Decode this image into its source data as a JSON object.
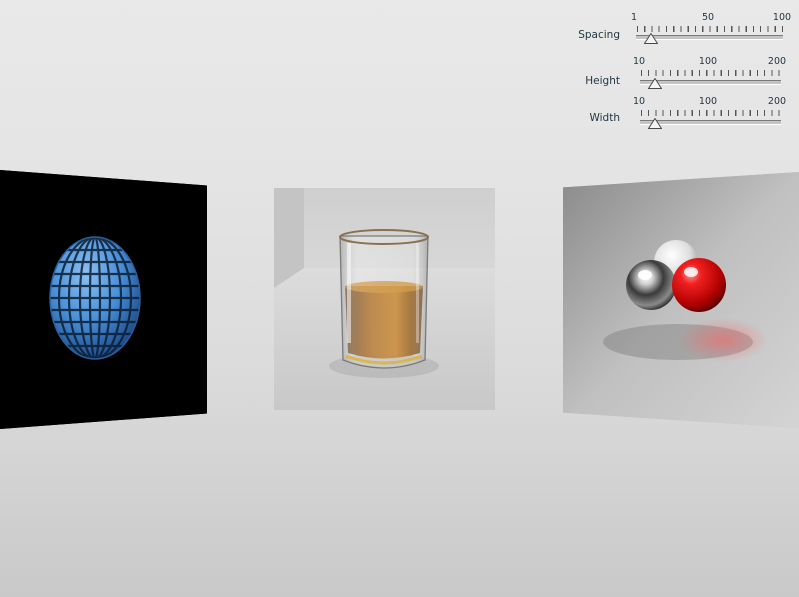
{
  "controls": {
    "spacing": {
      "label": "Spacing",
      "ticks": [
        "1",
        "50",
        "100"
      ],
      "min": 1,
      "max": 100,
      "value": 11
    },
    "height": {
      "label": "Height",
      "ticks": [
        "10",
        "100",
        "200"
      ],
      "min": 10,
      "max": 200,
      "value": 30
    },
    "width": {
      "label": "Width",
      "ticks": [
        "10",
        "100",
        "200"
      ],
      "min": 10,
      "max": 200,
      "value": 30
    }
  },
  "gallery": {
    "items": [
      {
        "subject": "blue-lattice-egg",
        "background": "#000000",
        "accent": "#4a8fd8"
      },
      {
        "subject": "whisky-glass",
        "background": "#dedede",
        "accent": "#9a5a10"
      },
      {
        "subject": "reflective-spheres",
        "background": "#b8b8b8",
        "accent": "#e01818"
      }
    ]
  }
}
